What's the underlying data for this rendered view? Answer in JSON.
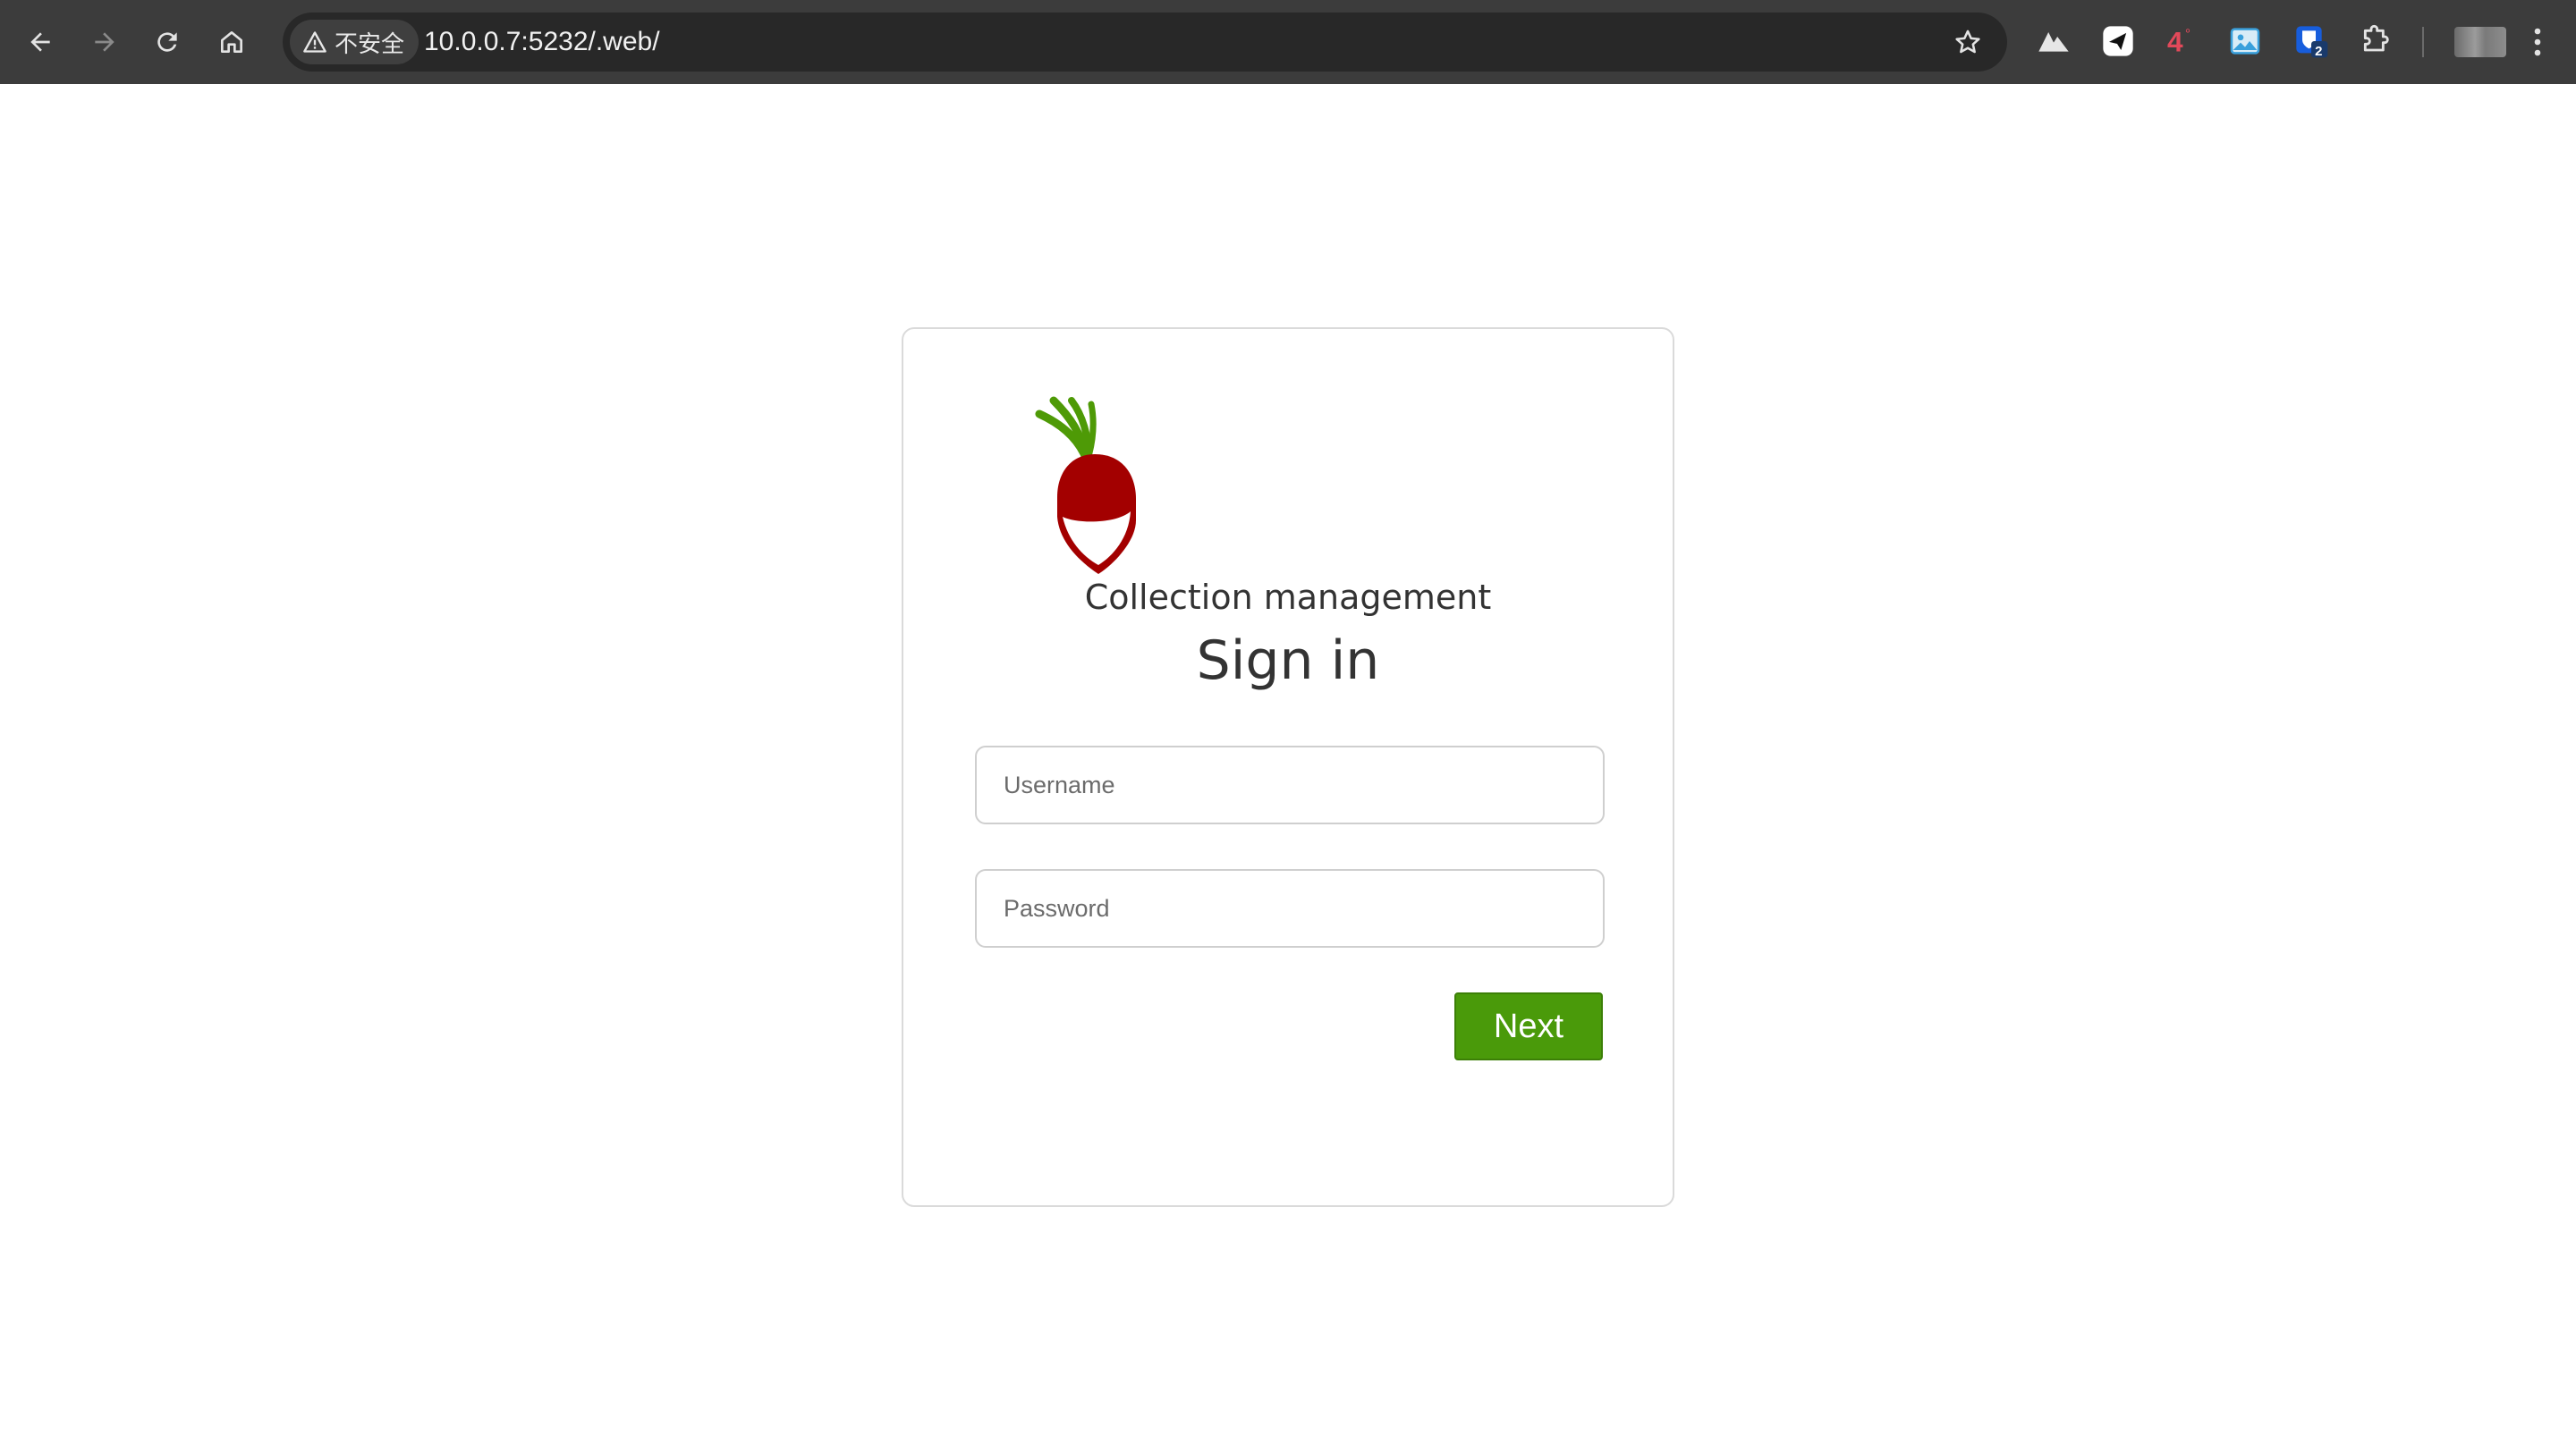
{
  "browser": {
    "security_label": "不安全",
    "url": "10.0.0.7:5232/.web/",
    "extensions": [
      {
        "name": "mountain-extension-icon"
      },
      {
        "name": "send-extension-icon"
      },
      {
        "name": "temperature-extension-icon",
        "label": "4°"
      },
      {
        "name": "image-extension-icon"
      },
      {
        "name": "bitwarden-extension-icon",
        "badge": "2"
      },
      {
        "name": "extensions-puzzle-icon"
      }
    ]
  },
  "page": {
    "subtitle": "Collection management",
    "heading": "Sign in",
    "username_placeholder": "Username",
    "password_placeholder": "Password",
    "next_label": "Next"
  },
  "colors": {
    "accent_green": "#4a9a0a",
    "radish_red": "#a30000",
    "leaf_green": "#4e9a06"
  }
}
